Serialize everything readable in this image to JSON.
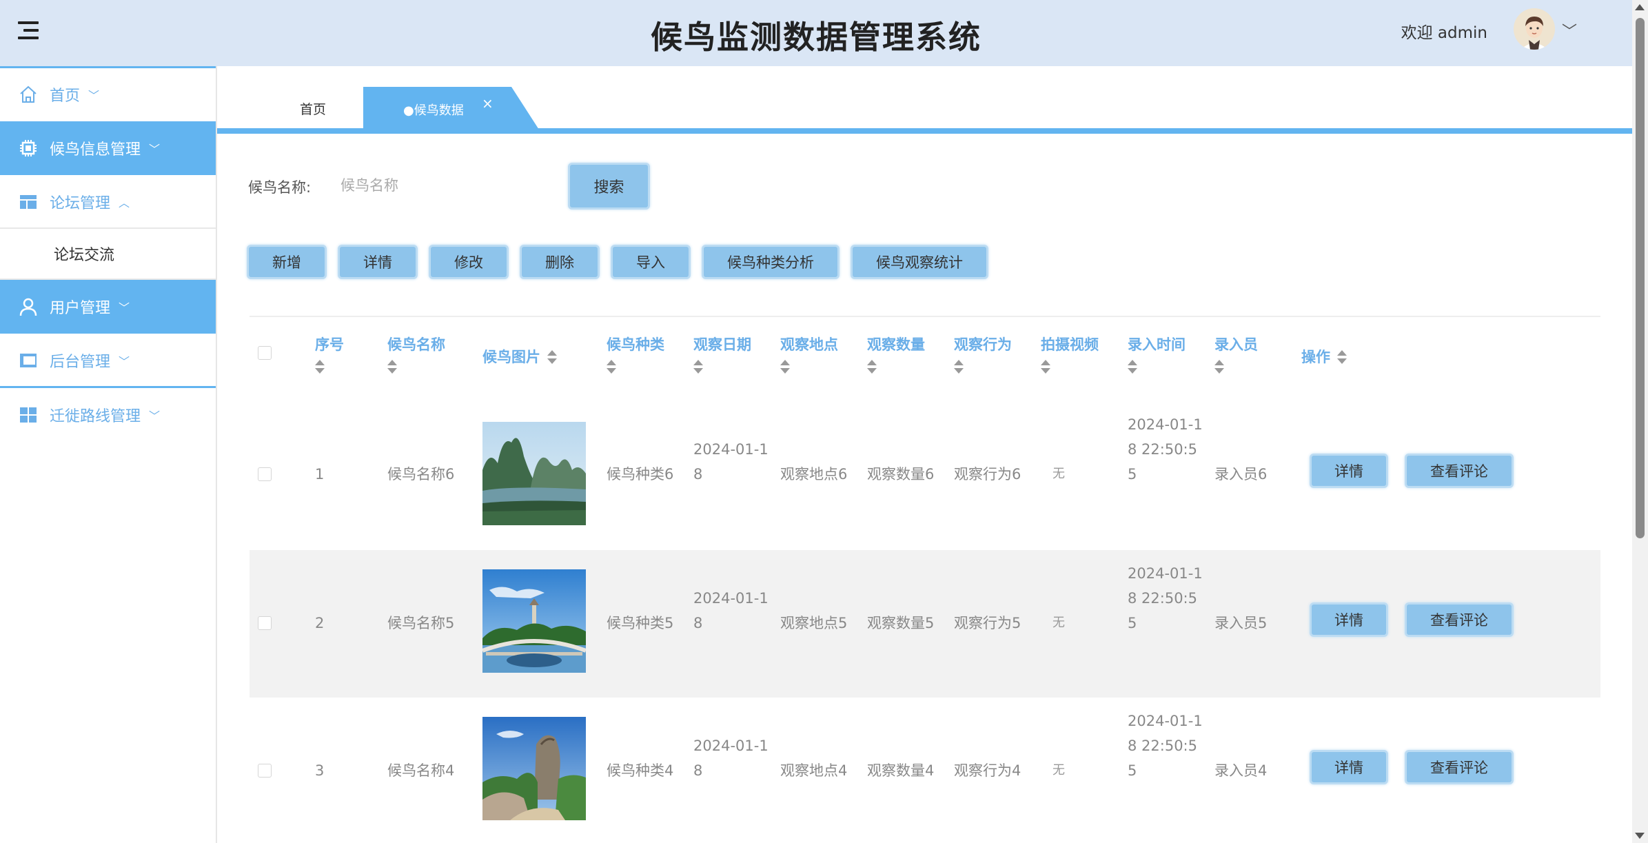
{
  "header": {
    "title": "候鸟监测数据管理系统",
    "welcome": "欢迎 admin"
  },
  "sidebar": {
    "items": [
      {
        "label": "首页",
        "caret": "﹀"
      },
      {
        "label": "候鸟信息管理",
        "caret": "﹀"
      },
      {
        "label": "论坛管理",
        "caret": "︿"
      },
      {
        "label": "论坛交流"
      },
      {
        "label": "用户管理",
        "caret": "﹀"
      },
      {
        "label": "后台管理",
        "caret": "﹀"
      },
      {
        "label": "迁徙路线管理",
        "caret": "﹀"
      }
    ]
  },
  "tabs": {
    "home": "首页",
    "active": "●候鸟数据",
    "close": "×"
  },
  "search": {
    "label": "候鸟名称:",
    "placeholder": "候鸟名称",
    "button": "搜索"
  },
  "toolbar": {
    "add": "新增",
    "detail": "详情",
    "edit": "修改",
    "delete": "删除",
    "import": "导入",
    "analysis": "候鸟种类分析",
    "stats": "候鸟观察统计"
  },
  "table": {
    "columns": [
      "序号",
      "候鸟名称",
      "候鸟图片",
      "候鸟种类",
      "观察日期",
      "观察地点",
      "观察数量",
      "观察行为",
      "拍摄视频",
      "录入时间",
      "录入员",
      "操作"
    ],
    "rows": [
      {
        "index": "1",
        "name": "候鸟名称6",
        "image": "karst-river",
        "type": "候鸟种类6",
        "date_1": "2024-01-1",
        "date_2": "8",
        "place": "观察地点6",
        "count": "观察数量6",
        "behavior": "观察行为6",
        "video": "无",
        "time_1": "2024-01-1",
        "time_2": "8 22:50:5",
        "time_3": "5",
        "recorder": "录入员6",
        "detail_btn": "详情",
        "comment_btn": "查看评论"
      },
      {
        "index": "2",
        "name": "候鸟名称5",
        "image": "lake-bridge-pagoda",
        "type": "候鸟种类5",
        "date_1": "2024-01-1",
        "date_2": "8",
        "place": "观察地点5",
        "count": "观察数量5",
        "behavior": "观察行为5",
        "video": "无",
        "time_1": "2024-01-1",
        "time_2": "8 22:50:5",
        "time_3": "5",
        "recorder": "录入员5",
        "detail_btn": "详情",
        "comment_btn": "查看评论"
      },
      {
        "index": "3",
        "name": "候鸟名称4",
        "image": "rock-peak-garden",
        "type": "候鸟种类4",
        "date_1": "2024-01-1",
        "date_2": "8",
        "place": "观察地点4",
        "count": "观察数量4",
        "behavior": "观察行为4",
        "video": "无",
        "time_1": "2024-01-1",
        "time_2": "8 22:50:5",
        "time_3": "5",
        "recorder": "录入员4",
        "detail_btn": "详情",
        "comment_btn": "查看评论"
      }
    ]
  },
  "colors": {
    "header_bg": "#dae6f5",
    "accent": "#62b4f0",
    "button_bg": "#8ec4eb",
    "link_text": "#6aaee8"
  },
  "icons": [
    "menu-icon",
    "home-icon",
    "chip-icon",
    "layout-icon",
    "user-icon",
    "panel-icon",
    "grid-icon",
    "chevron-down-icon",
    "close-icon",
    "sort-icon"
  ]
}
